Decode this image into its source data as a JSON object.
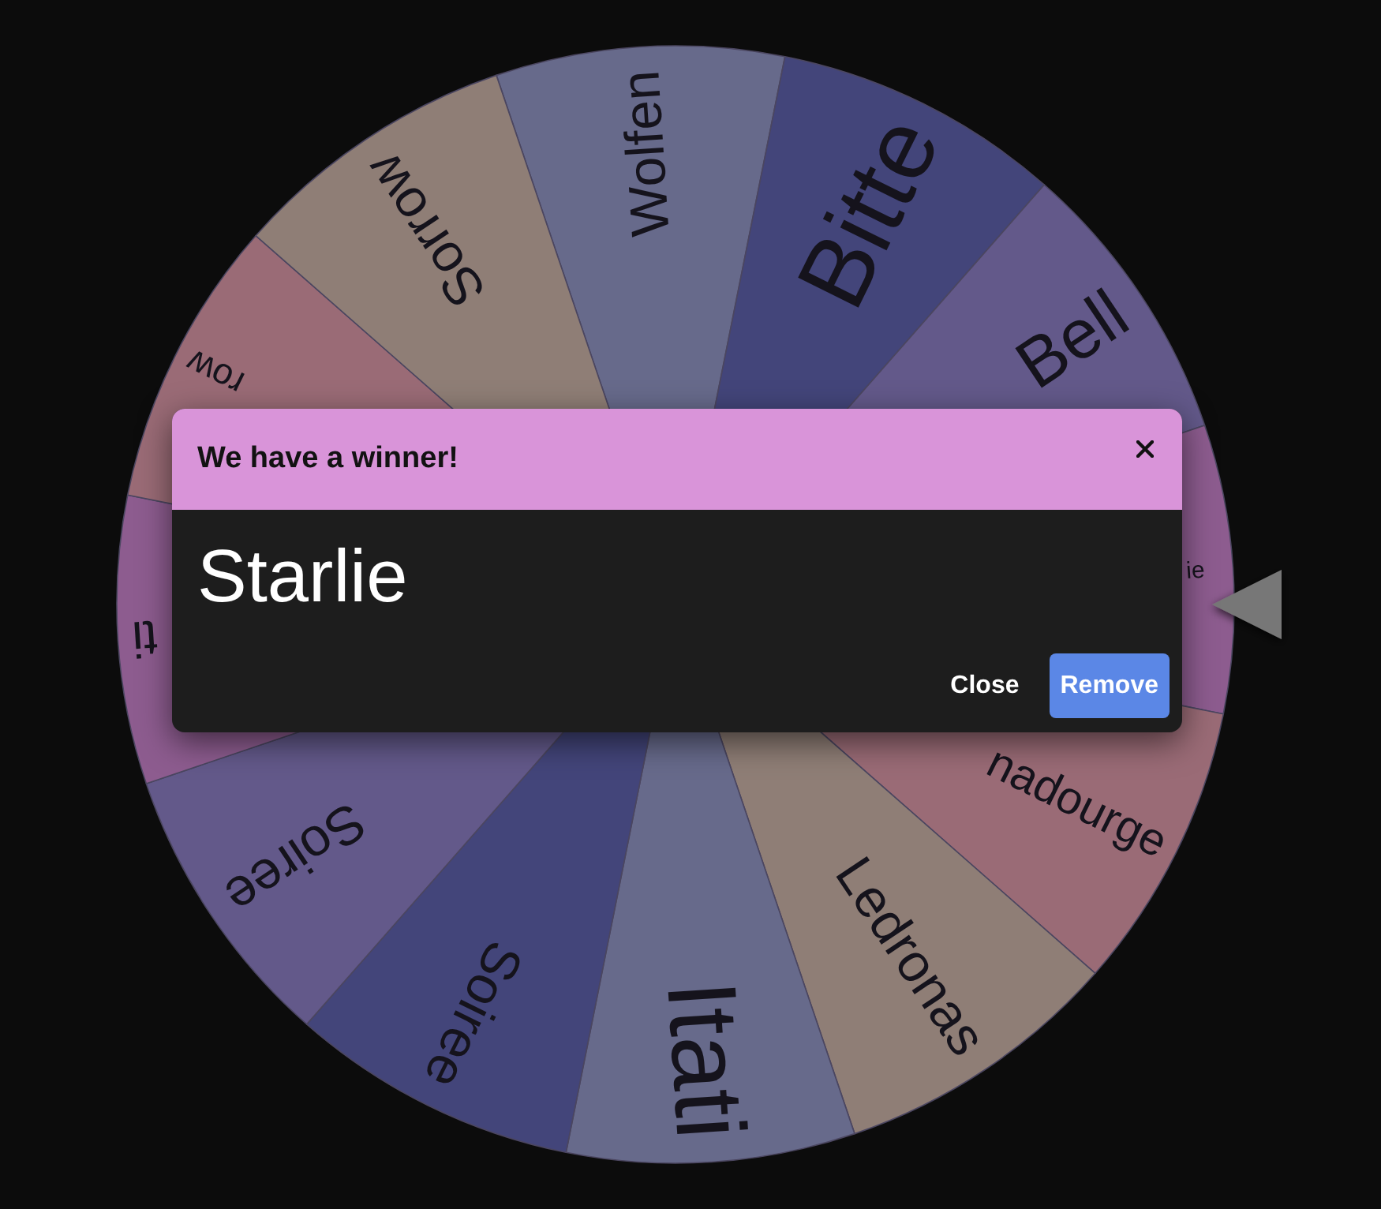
{
  "wheel": {
    "segments": [
      {
        "label": "Wolfen",
        "color": "#676a8b",
        "cut_off": false
      },
      {
        "label": "Bitte",
        "color": "#43457a",
        "cut_off": false
      },
      {
        "label": "Bell",
        "color": "#63598a",
        "cut_off": false
      },
      {
        "label": "ie",
        "color": "#8d5c8f",
        "cut_off": true
      },
      {
        "label": "nadourge",
        "color": "#9a6b76",
        "cut_off": true
      },
      {
        "label": "Ledronas",
        "color": "#8f7e76",
        "cut_off": false
      },
      {
        "label": "Itati",
        "color": "#676a8b",
        "cut_off": false
      },
      {
        "label": "Soiree",
        "color": "#43457a",
        "cut_off": false
      },
      {
        "label": "Soiree",
        "color": "#63598a",
        "cut_off": false
      },
      {
        "label": "ti",
        "color": "#8d5c8f",
        "cut_off": true
      },
      {
        "label": "row",
        "color": "#9a6b76",
        "cut_off": true
      },
      {
        "label": "Sorrow",
        "color": "#8f7e76",
        "cut_off": false
      }
    ]
  },
  "dialog": {
    "title": "We have a winner!",
    "winner": "Starlie",
    "buttons": [
      {
        "label": "Close",
        "kind": "text"
      },
      {
        "label": "Remove",
        "kind": "filled"
      }
    ]
  }
}
